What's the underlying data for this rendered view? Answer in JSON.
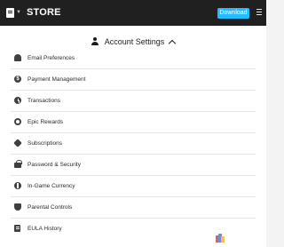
{
  "topbar": {
    "logo_icon": "epic-games-logo-icon",
    "title": "STORE",
    "download_label": "Download",
    "download_color": "#26bbff",
    "menu_icon": "hamburger-menu-icon"
  },
  "account_menu": {
    "header_label": "Account Settings",
    "expanded": true,
    "items": [
      {
        "label": "Email Preferences",
        "icon": "bell-icon"
      },
      {
        "label": "Payment Management",
        "icon": "dollar-icon"
      },
      {
        "label": "Transactions",
        "icon": "clock-icon"
      },
      {
        "label": "Epic Rewards",
        "icon": "rewards-icon"
      },
      {
        "label": "Subscriptions",
        "icon": "subscriptions-icon"
      },
      {
        "label": "Password & Security",
        "icon": "lock-icon"
      },
      {
        "label": "In-Game Currency",
        "icon": "coin-icon"
      },
      {
        "label": "Parental Controls",
        "icon": "shield-icon"
      },
      {
        "label": "EULA History",
        "icon": "document-icon"
      }
    ]
  },
  "floating_widget": {
    "icon": "app-widget-icon"
  }
}
